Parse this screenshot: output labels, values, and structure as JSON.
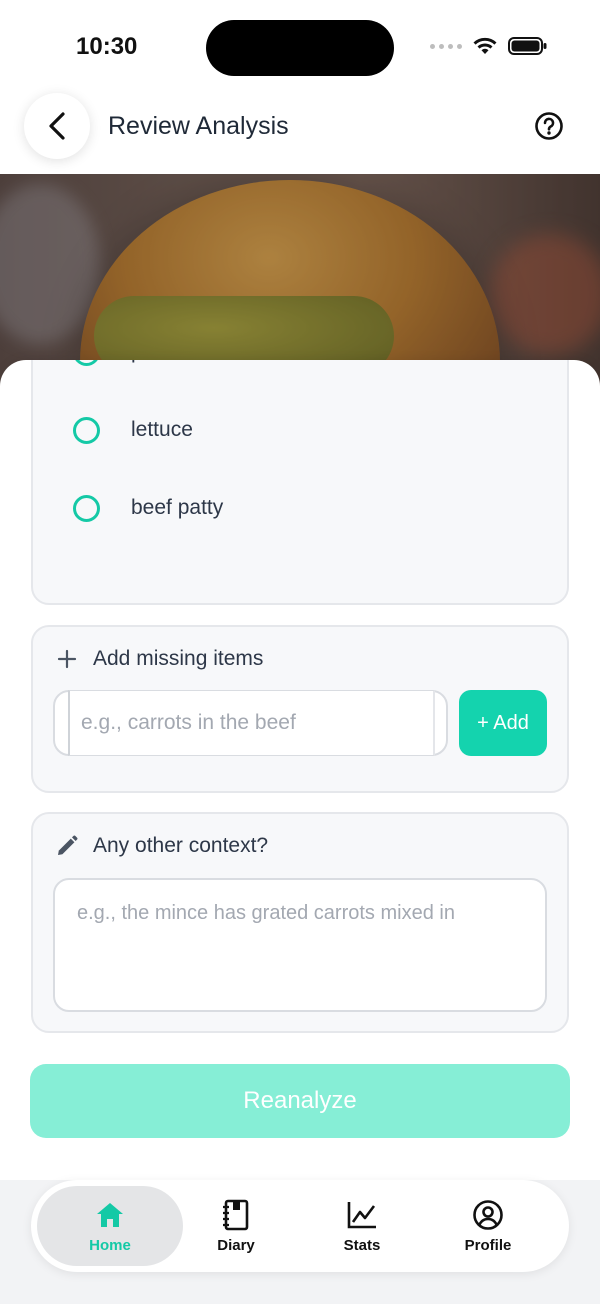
{
  "status_bar": {
    "time": "10:30"
  },
  "header": {
    "title": "Review Analysis"
  },
  "ingredients": [
    {
      "label": "pickle"
    },
    {
      "label": "lettuce"
    },
    {
      "label": "beef patty"
    }
  ],
  "add_missing": {
    "heading": "Add missing items",
    "input_placeholder": "e.g., carrots in the beef",
    "add_button_label": "+ Add"
  },
  "context": {
    "heading": "Any other context?",
    "placeholder": "e.g., the mince has grated carrots mixed in"
  },
  "reanalyze_label": "Reanalyze",
  "nav": {
    "tabs": [
      {
        "label": "Home",
        "icon": "home-icon",
        "active": true
      },
      {
        "label": "Diary",
        "icon": "notebook-icon",
        "active": false
      },
      {
        "label": "Stats",
        "icon": "chart-icon",
        "active": false
      },
      {
        "label": "Profile",
        "icon": "user-circle-icon",
        "active": false
      }
    ]
  },
  "colors": {
    "accent": "#14d3ae",
    "accent_disabled": "#86eed6",
    "card_bg": "#f7f8fa"
  }
}
